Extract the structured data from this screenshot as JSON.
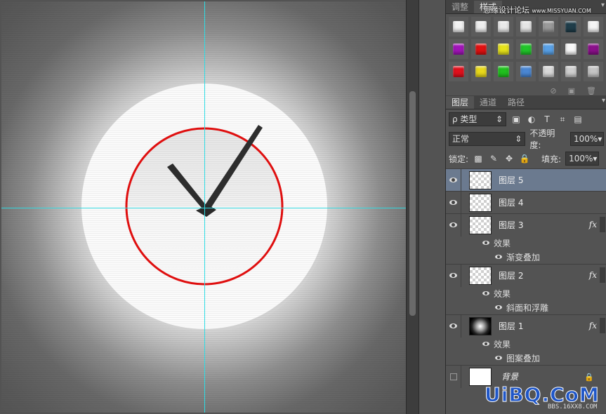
{
  "panels": {
    "top_tabs": [
      "调整",
      "样式"
    ],
    "styles": {
      "swatches": [
        "#f1f1f1",
        "#ededed",
        "#e9e9e9",
        "#e5e5e5",
        "#9a9a9a",
        "#1f3d4a",
        "#f5f5f5",
        "#a114b8",
        "#e01010",
        "#e6e21a",
        "#21c42a",
        "#58a0e6",
        "#f8f8f8",
        "#8a108a",
        "#e0101c",
        "#e8d81a",
        "#20c01e",
        "#4a86d2",
        "#d8d8d8",
        "#cfcfcf",
        "#c4c4c4"
      ],
      "footer_icons": [
        "no-icon",
        "new-style-icon",
        "trash-icon"
      ]
    }
  },
  "layers_panel": {
    "tabs": [
      "图层",
      "通道",
      "路径"
    ],
    "filter_label": "ρ 类型",
    "blend_mode": "正常",
    "opacity_label": "不透明度:",
    "opacity_value": "100%",
    "lock_label": "锁定:",
    "fill_label": "填充:",
    "fill_value": "100%",
    "layers": [
      {
        "name": "图层 5",
        "selected": true,
        "thumb": "checker"
      },
      {
        "name": "图层 4",
        "thumb": "checker"
      },
      {
        "name": "图层 3",
        "thumb": "checker",
        "fx": "fx",
        "effects_label": "效果",
        "effects": [
          "渐变叠加"
        ]
      },
      {
        "name": "图层 2",
        "thumb": "checker",
        "fx": "fx",
        "effects_label": "效果",
        "effects": [
          "斜面和浮雕"
        ]
      },
      {
        "name": "图层 1",
        "thumb": "radial",
        "fx": "fx",
        "effects_label": "效果",
        "effects": [
          "图案叠加"
        ]
      },
      {
        "name": "背景",
        "thumb": "white",
        "locked": true
      }
    ]
  },
  "watermarks": {
    "top": "思缘设计论坛",
    "top_small": "www.MISSYUAN.COM",
    "bottom": "UiBQ.CoM",
    "bottom_sub": "BBS.16XX8.COM"
  }
}
